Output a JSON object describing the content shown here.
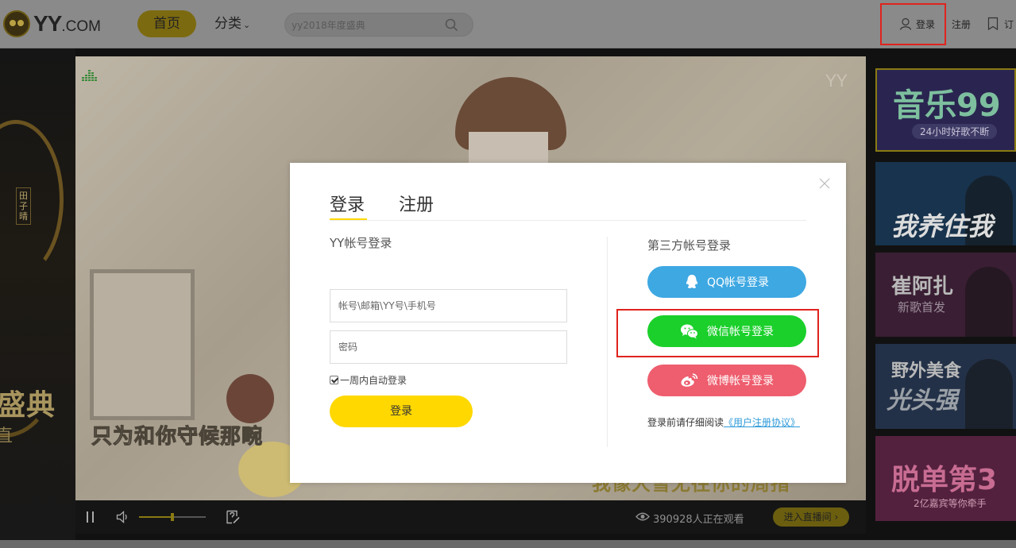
{
  "header": {
    "logo_text": "YY",
    "logo_suffix": ".COM",
    "nav_home": "首页",
    "nav_category": "分类",
    "search_placeholder": "yy2018年度盛典",
    "login": "登录",
    "register": "注册",
    "subscribe": "订"
  },
  "left_banner": {
    "name_tag": "田子晴",
    "big_text": "盛典",
    "small_text": "直"
  },
  "player": {
    "watermark": "YY",
    "caption_left": "只为和你守候那畹",
    "caption_right": "我像大雪无往你的周措",
    "viewers": "390928人正在观看",
    "enter_room": "进入直播间",
    "volume_level": 0.5
  },
  "recommendations": [
    {
      "title": "音乐99",
      "sub": "24小时好歌不断"
    },
    {
      "title": "我养住我",
      "sub": ""
    },
    {
      "title": "崔阿扎",
      "sub": "新歌首发"
    },
    {
      "title": "野外美食",
      "sub": "光头强"
    },
    {
      "title": "脱单第3",
      "sub": "2亿嘉宾等你牵手"
    }
  ],
  "modal": {
    "tab_login": "登录",
    "tab_register": "注册",
    "yy_login_title": "YY帐号登录",
    "account_placeholder": "帐号\\邮箱\\YY号\\手机号",
    "password_placeholder": "密码",
    "remember_label": "一周内自动登录",
    "login_button": "登录",
    "third_party_title": "第三方帐号登录",
    "qq_button": "QQ帐号登录",
    "wechat_button": "微信帐号登录",
    "weibo_button": "微博帐号登录",
    "agreement_prefix": "登录前请仔细阅读",
    "agreement_link": "《用户注册协议》"
  },
  "icons": {
    "search": "search-icon",
    "user": "user-icon",
    "subscribe": "bookmark-icon",
    "close": "close-icon",
    "qq": "qq-icon",
    "wechat": "wechat-icon",
    "weibo": "weibo-icon",
    "eye": "eye-icon"
  },
  "colors": {
    "accent_yellow": "#ffd800",
    "qq_blue": "#3ea8e2",
    "wechat_green": "#1bd02b",
    "weibo_red": "#ee5e6e",
    "highlight_red": "#e0231e",
    "link_blue": "#2e9ad9"
  }
}
